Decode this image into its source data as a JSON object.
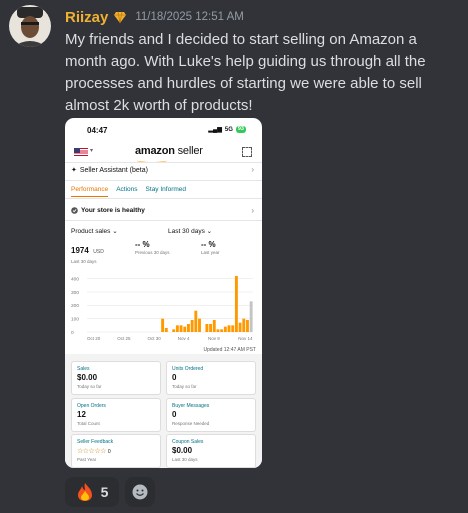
{
  "message": {
    "username": "Riizay",
    "timestamp": "11/18/2025 12:51 AM",
    "text": "My friends and I decided to start selling on Amazon a month ago. With Luke's help guiding us through all the processes and hurdles of starting we were able to sell almost 2k worth of products!"
  },
  "phone": {
    "status_time": "04:47",
    "status_network": "5G",
    "battery": "93",
    "logo_brand": "amazon",
    "logo_suffix": " seller",
    "assistant_label": "Seller Assistant (beta)",
    "tabs": [
      "Performance",
      "Actions",
      "Stay Informed"
    ],
    "health_text": "Your store is healthy",
    "metric_dropdown": "Product sales",
    "period_dropdown": "Last 30 days",
    "metrics": [
      {
        "value": "1974",
        "unit": "USD",
        "sub": "Last 30 days"
      },
      {
        "value": "-- %",
        "sub": "Previous 30 days"
      },
      {
        "value": "-- %",
        "sub": "Last year"
      }
    ],
    "updated": "Updated 12:47 AM PST",
    "cards": [
      {
        "label": "Sales",
        "value": "$0.00",
        "sub": "Today so far"
      },
      {
        "label": "Units Ordered",
        "value": "0",
        "sub": "Today so far"
      },
      {
        "label": "Open Orders",
        "value": "12",
        "sub": "Total Count"
      },
      {
        "label": "Buyer Messages",
        "value": "0",
        "sub": "Response Needed"
      },
      {
        "label": "Seller Feedback",
        "value": "0",
        "sub": "Past Year"
      },
      {
        "label": "Coupon Sales",
        "value": "$0.00",
        "sub": "Last 30 days"
      }
    ]
  },
  "reactions": [
    {
      "emoji": "fire-emoji",
      "count": "5"
    }
  ],
  "colors": {
    "username": "#f0b132",
    "bar_orange": "#ff9900",
    "bar_gray": "#c4c4c4",
    "link_teal": "#007185"
  },
  "chart_data": {
    "type": "bar",
    "y_ticks": [
      "400",
      "300",
      "200",
      "100",
      "0"
    ],
    "x_ticks": [
      "Oct 20",
      "Oct 25",
      "Oct 30",
      "Nov 4",
      "Nov 9",
      "Nov 14"
    ],
    "ylim": [
      0,
      450
    ],
    "values": [
      0,
      0,
      0,
      0,
      0,
      0,
      0,
      0,
      0,
      0,
      0,
      0,
      0,
      0,
      0,
      0,
      0,
      0,
      0,
      0,
      100,
      30,
      0,
      20,
      50,
      50,
      40,
      60,
      90,
      160,
      100,
      0,
      60,
      60,
      90,
      20,
      20,
      40,
      50,
      50,
      420,
      70,
      100,
      90,
      230
    ],
    "highlight_last_gray": true
  }
}
